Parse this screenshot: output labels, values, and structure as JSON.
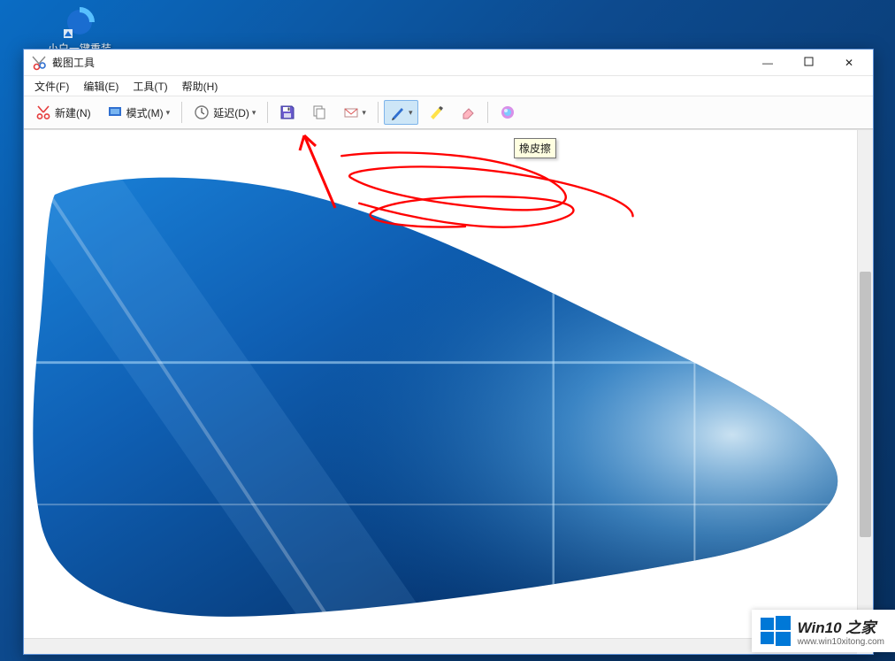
{
  "desktop": {
    "icon_label": "小白一键重装\n系统"
  },
  "window": {
    "title": "截图工具",
    "controls": {
      "min": "—",
      "max": "▢",
      "close": "✕"
    }
  },
  "menu": {
    "file": "文件(F)",
    "edit": "编辑(E)",
    "tools": "工具(T)",
    "help": "帮助(H)"
  },
  "toolbar": {
    "new_label": "新建(N)",
    "mode_label": "模式(M)",
    "delay_label": "延迟(D)"
  },
  "tooltip": {
    "eraser": "橡皮擦"
  },
  "watermark": {
    "title": "Win10 之家",
    "url": "www.win10xitong.com"
  }
}
